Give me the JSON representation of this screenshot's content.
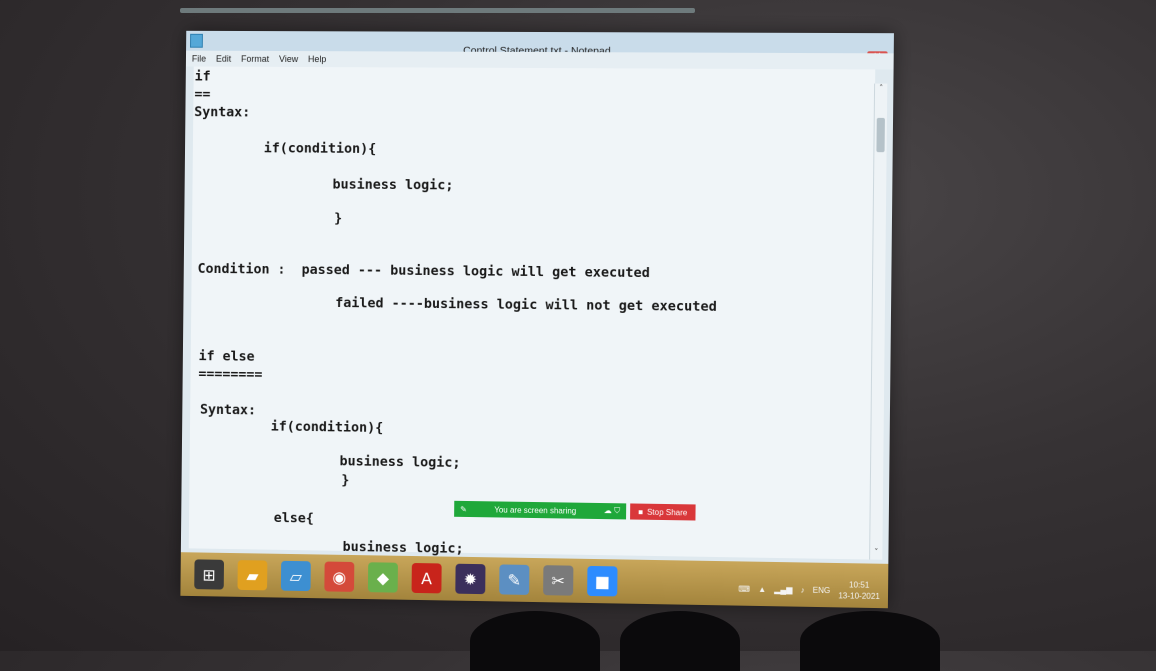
{
  "window": {
    "title": "Control Statement.txt - Notepad",
    "controls": {
      "minimize": "–",
      "maximize": "▫",
      "close": "✕"
    }
  },
  "menu": [
    "File",
    "Edit",
    "Format",
    "View",
    "Help"
  ],
  "editor": {
    "lines": [
      "if",
      "==",
      "Syntax:",
      "if(condition){",
      "business logic;",
      "}",
      "Condition :  passed --- business logic will get executed",
      "failed ----business logic will not get executed",
      "if else",
      "========",
      "Syntax:",
      "if(condition){",
      "business logic;",
      "}",
      "else{",
      "business logic;"
    ]
  },
  "scrollbar": {
    "up": "˄",
    "down": "˅"
  },
  "screen_share": {
    "status": "You are screen sharing",
    "stop_label": "Stop Share"
  },
  "taskbar": {
    "apps": [
      {
        "name": "windows-start",
        "glyph": "⊞",
        "color": "#3a3a3a"
      },
      {
        "name": "file-explorer",
        "glyph": "▰",
        "color": "#e0a020"
      },
      {
        "name": "notepad",
        "glyph": "▱",
        "color": "#3d8fd1"
      },
      {
        "name": "chrome",
        "glyph": "◉",
        "color": "#d44a3a"
      },
      {
        "name": "maps",
        "glyph": "◆",
        "color": "#6ab04c"
      },
      {
        "name": "acrobat",
        "glyph": "A",
        "color": "#c8241b"
      },
      {
        "name": "eclipse",
        "glyph": "✹",
        "color": "#3b2f5b"
      },
      {
        "name": "paint",
        "glyph": "✎",
        "color": "#5c8fc2"
      },
      {
        "name": "snipping-tool",
        "glyph": "✂",
        "color": "#7a7a7a"
      },
      {
        "name": "zoom",
        "glyph": "■",
        "color": "#2d8cff"
      }
    ],
    "tray": {
      "language": "ENG",
      "time": "10:51",
      "date": "13-10-2021"
    }
  }
}
